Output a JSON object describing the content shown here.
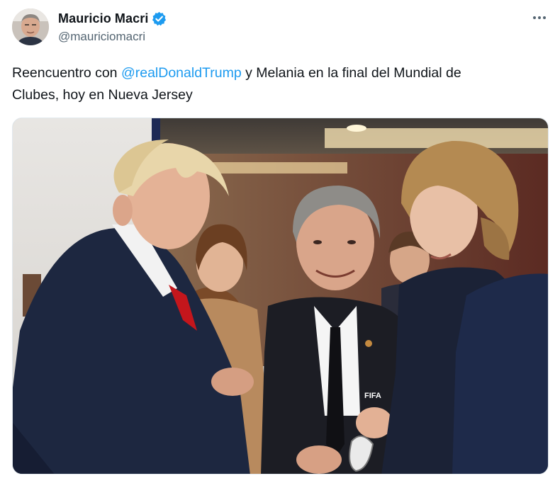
{
  "tweet": {
    "author": {
      "display_name": "Mauricio Macri",
      "handle": "@mauriciomacri",
      "verified": true,
      "verified_color": "#1d9bf0"
    },
    "more_icon": "more-horizontal-icon",
    "text": {
      "part1": "Reencuentro con ",
      "mention": "@realDonaldTrump",
      "part2": " y Melania en la final del Mundial de",
      "line2": "Clubes, hoy en Nueva Jersey"
    },
    "photo": {
      "badge_text": "FIFA"
    },
    "colors": {
      "link": "#1d9bf0",
      "secondary_text": "#536471",
      "primary_text": "#0f1419"
    }
  }
}
